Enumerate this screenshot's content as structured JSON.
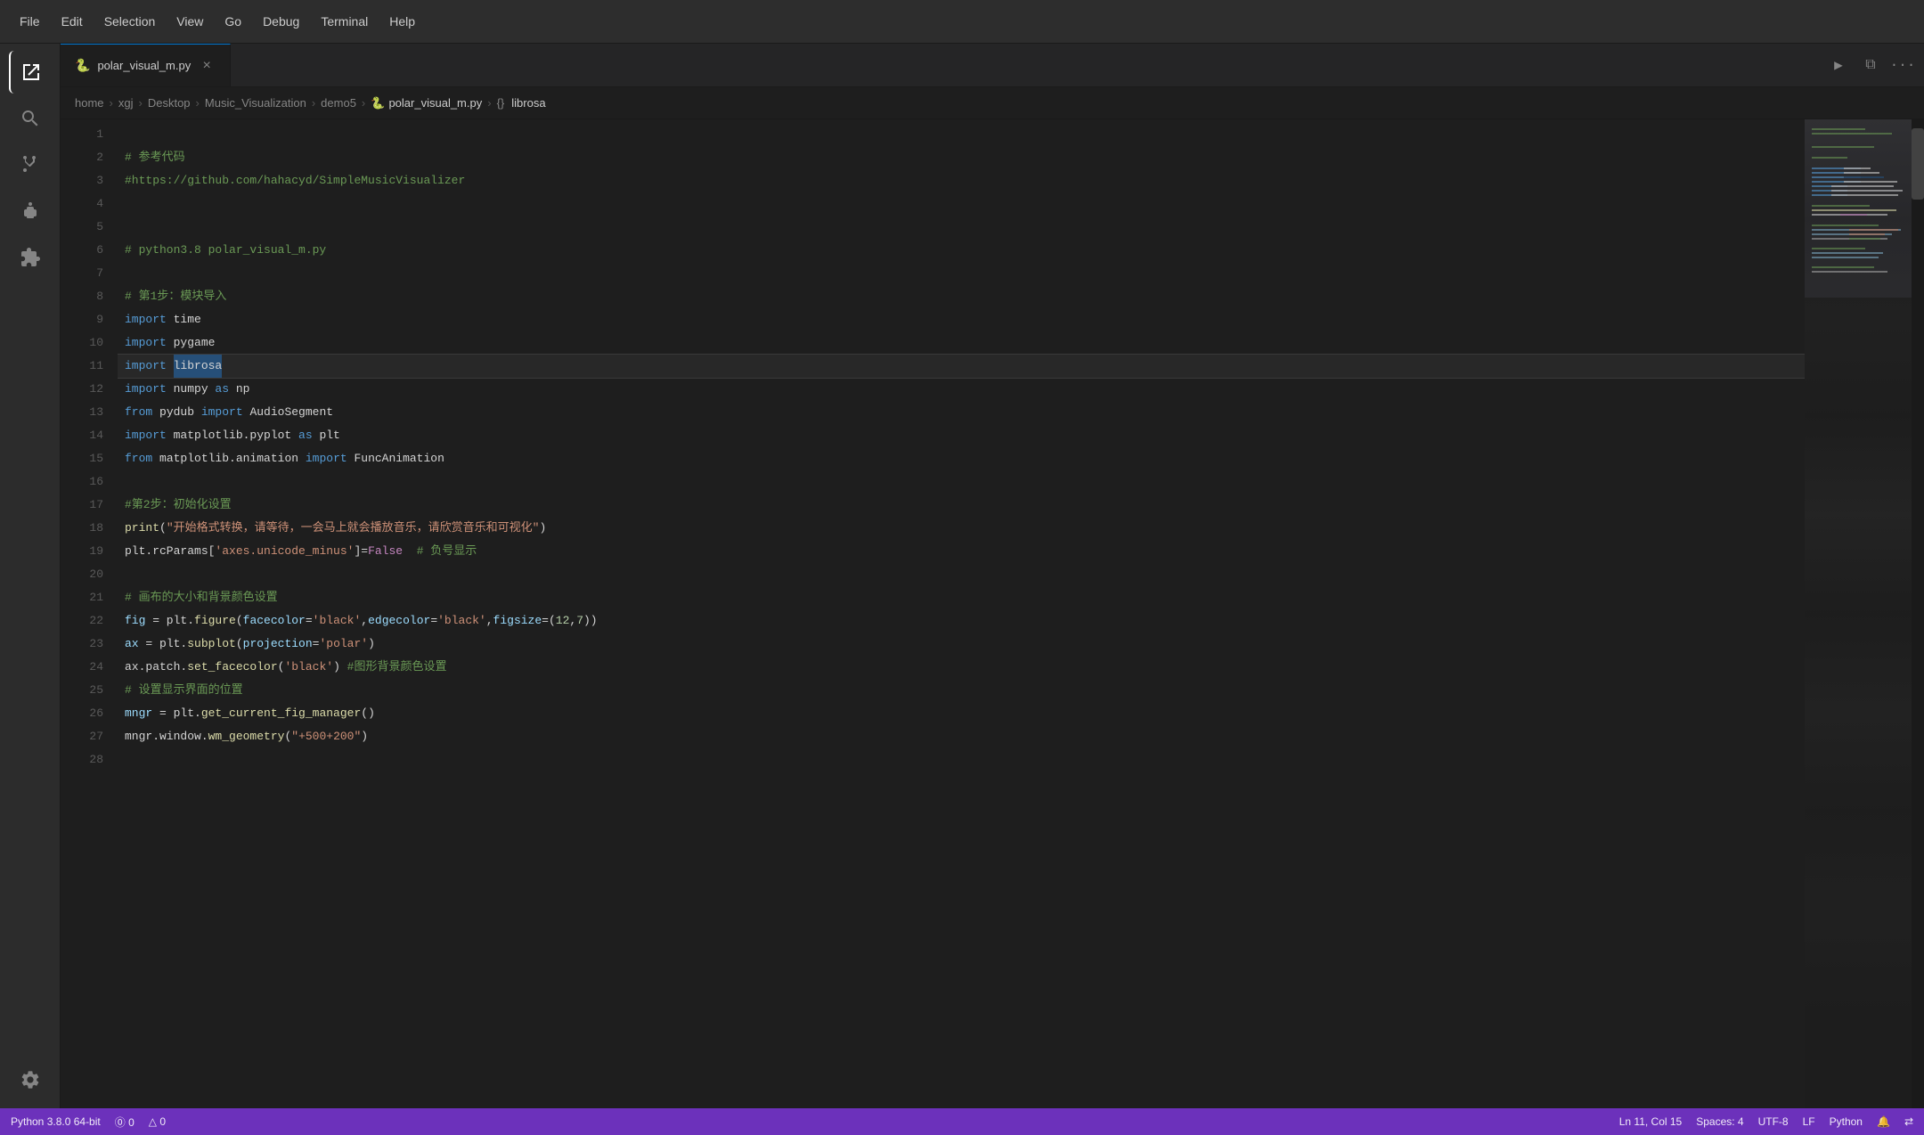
{
  "menu": {
    "items": [
      "File",
      "Edit",
      "Selection",
      "View",
      "Go",
      "Debug",
      "Terminal",
      "Help"
    ]
  },
  "activity_bar": {
    "icons": [
      {
        "name": "explorer-icon",
        "symbol": "⧉",
        "active": true
      },
      {
        "name": "search-icon",
        "symbol": "🔍",
        "active": false
      },
      {
        "name": "source-control-icon",
        "symbol": "⑂",
        "active": false
      },
      {
        "name": "debug-icon",
        "symbol": "🐞",
        "active": false
      },
      {
        "name": "extensions-icon",
        "symbol": "⊞",
        "active": false
      }
    ],
    "bottom_icons": [
      {
        "name": "settings-icon",
        "symbol": "⚙",
        "active": false
      }
    ]
  },
  "tab": {
    "filename": "polar_visual_m.py",
    "icon": "🐍",
    "close_label": "×"
  },
  "tab_actions": {
    "run_label": "▶",
    "split_label": "⧉",
    "more_label": "···"
  },
  "breadcrumb": {
    "parts": [
      "home",
      "xgj",
      "Desktop",
      "Music_Visualization",
      "demo5",
      "polar_visual_m.py",
      "librosa"
    ],
    "separators": [
      ">",
      ">",
      ">",
      ">",
      ">",
      ">"
    ]
  },
  "code": {
    "lines": [
      {
        "num": 1,
        "content": "",
        "tokens": []
      },
      {
        "num": 2,
        "content": "# 参考代码",
        "tokens": [
          {
            "t": "cmt",
            "v": "# 参考代码"
          }
        ]
      },
      {
        "num": 3,
        "content": "#https://github.com/hahacyd/SimpleMusicVisualizer",
        "tokens": [
          {
            "t": "cmt",
            "v": "#https://github.com/hahacyd/SimpleMusicVisualizer"
          }
        ]
      },
      {
        "num": 4,
        "content": "",
        "tokens": []
      },
      {
        "num": 5,
        "content": "",
        "tokens": []
      },
      {
        "num": 6,
        "content": "# python3.8 polar_visual_m.py",
        "tokens": [
          {
            "t": "cmt",
            "v": "# python3.8 polar_visual_m.py"
          }
        ]
      },
      {
        "num": 7,
        "content": "",
        "tokens": []
      },
      {
        "num": 8,
        "content": "# 第1步：模块导入",
        "tokens": [
          {
            "t": "cmt",
            "v": "# 第1步：模块导入"
          }
        ]
      },
      {
        "num": 9,
        "content": "import time",
        "tokens": [
          {
            "t": "kw",
            "v": "import"
          },
          {
            "t": "plain",
            "v": " time"
          }
        ]
      },
      {
        "num": 10,
        "content": "import pygame",
        "tokens": [
          {
            "t": "kw",
            "v": "import"
          },
          {
            "t": "plain",
            "v": " pygame"
          }
        ]
      },
      {
        "num": 11,
        "content": "import librosa",
        "tokens": [
          {
            "t": "kw",
            "v": "import"
          },
          {
            "t": "plain",
            "v": " "
          },
          {
            "t": "highlight",
            "v": "librosa"
          }
        ],
        "active": true
      },
      {
        "num": 12,
        "content": "import numpy as np",
        "tokens": [
          {
            "t": "kw",
            "v": "import"
          },
          {
            "t": "plain",
            "v": " numpy "
          },
          {
            "t": "kw",
            "v": "as"
          },
          {
            "t": "plain",
            "v": " np"
          }
        ]
      },
      {
        "num": 13,
        "content": "from pydub import AudioSegment",
        "tokens": [
          {
            "t": "kw",
            "v": "from"
          },
          {
            "t": "plain",
            "v": " pydub "
          },
          {
            "t": "kw",
            "v": "import"
          },
          {
            "t": "plain",
            "v": " AudioSegment"
          }
        ]
      },
      {
        "num": 14,
        "content": "import matplotlib.pyplot as plt",
        "tokens": [
          {
            "t": "kw",
            "v": "import"
          },
          {
            "t": "plain",
            "v": " matplotlib.pyplot "
          },
          {
            "t": "kw",
            "v": "as"
          },
          {
            "t": "plain",
            "v": " plt"
          }
        ]
      },
      {
        "num": 15,
        "content": "from matplotlib.animation import FuncAnimation",
        "tokens": [
          {
            "t": "kw",
            "v": "from"
          },
          {
            "t": "plain",
            "v": " matplotlib.animation "
          },
          {
            "t": "kw",
            "v": "import"
          },
          {
            "t": "plain",
            "v": " FuncAnimation"
          }
        ]
      },
      {
        "num": 16,
        "content": "",
        "tokens": []
      },
      {
        "num": 17,
        "content": "#第2步：初始化设置",
        "tokens": [
          {
            "t": "cmt",
            "v": "#第2步：初始化设置"
          }
        ]
      },
      {
        "num": 18,
        "content": "print(\"开始格式转换，请等待，一会马上就会播放音乐，请欣赏音乐和可视化\")",
        "tokens": [
          {
            "t": "fn",
            "v": "print"
          },
          {
            "t": "plain",
            "v": "("
          },
          {
            "t": "str",
            "v": "\"开始格式转换，请等待，一会马上就会播放音乐，请欣赏音乐和可视化\""
          },
          {
            "t": "plain",
            "v": ")"
          }
        ]
      },
      {
        "num": 19,
        "content": "plt.rcParams['axes.unicode_minus']=False  # 负号显示",
        "tokens": [
          {
            "t": "plain",
            "v": "plt.rcParams["
          },
          {
            "t": "str",
            "v": "'axes.unicode_minus'"
          },
          {
            "t": "plain",
            "v": "]="
          },
          {
            "t": "special",
            "v": "False"
          },
          {
            "t": "plain",
            "v": "  "
          },
          {
            "t": "cmt",
            "v": "# 负号显示"
          }
        ]
      },
      {
        "num": 20,
        "content": "",
        "tokens": []
      },
      {
        "num": 21,
        "content": "# 画布的大小和背景颜色设置",
        "tokens": [
          {
            "t": "cmt",
            "v": "# 画布的大小和背景颜色设置"
          }
        ]
      },
      {
        "num": 22,
        "content": "fig = plt.figure(facecolor='black',edgecolor='black',figsize=(12,7))",
        "tokens": [
          {
            "t": "var",
            "v": "fig"
          },
          {
            "t": "plain",
            "v": " = plt."
          },
          {
            "t": "fn",
            "v": "figure"
          },
          {
            "t": "plain",
            "v": "("
          },
          {
            "t": "param",
            "v": "facecolor"
          },
          {
            "t": "plain",
            "v": "="
          },
          {
            "t": "str",
            "v": "'black'"
          },
          {
            "t": "plain",
            "v": ","
          },
          {
            "t": "param",
            "v": "edgecolor"
          },
          {
            "t": "plain",
            "v": "="
          },
          {
            "t": "str",
            "v": "'black'"
          },
          {
            "t": "plain",
            "v": ","
          },
          {
            "t": "param",
            "v": "figsize"
          },
          {
            "t": "plain",
            "v": "=("
          },
          {
            "t": "num",
            "v": "12"
          },
          {
            "t": "plain",
            "v": ","
          },
          {
            "t": "num",
            "v": "7"
          },
          {
            "t": "plain",
            "v": "))"
          }
        ]
      },
      {
        "num": 23,
        "content": "ax = plt.subplot(projection='polar')",
        "tokens": [
          {
            "t": "var",
            "v": "ax"
          },
          {
            "t": "plain",
            "v": " = plt."
          },
          {
            "t": "fn",
            "v": "subplot"
          },
          {
            "t": "plain",
            "v": "("
          },
          {
            "t": "param",
            "v": "projection"
          },
          {
            "t": "plain",
            "v": "="
          },
          {
            "t": "str",
            "v": "'polar'"
          },
          {
            "t": "plain",
            "v": ")"
          }
        ]
      },
      {
        "num": 24,
        "content": "ax.patch.set_facecolor('black') #图形背景颜色设置",
        "tokens": [
          {
            "t": "plain",
            "v": "ax.patch."
          },
          {
            "t": "fn",
            "v": "set_facecolor"
          },
          {
            "t": "plain",
            "v": "("
          },
          {
            "t": "str",
            "v": "'black'"
          },
          {
            "t": "plain",
            "v": ") "
          },
          {
            "t": "cmt",
            "v": "#图形背景颜色设置"
          }
        ]
      },
      {
        "num": 25,
        "content": "# 设置显示界面的位置",
        "tokens": [
          {
            "t": "cmt",
            "v": "# 设置显示界面的位置"
          }
        ]
      },
      {
        "num": 26,
        "content": "mngr = plt.get_current_fig_manager()",
        "tokens": [
          {
            "t": "var",
            "v": "mngr"
          },
          {
            "t": "plain",
            "v": " = plt."
          },
          {
            "t": "fn",
            "v": "get_current_fig_manager"
          },
          {
            "t": "plain",
            "v": "()"
          }
        ]
      },
      {
        "num": 27,
        "content": "mngr.window.wm_geometry(\"+500+200\")",
        "tokens": [
          {
            "t": "plain",
            "v": "mngr.window."
          },
          {
            "t": "fn",
            "v": "wm_geometry"
          },
          {
            "t": "plain",
            "v": "("
          },
          {
            "t": "str",
            "v": "\"+500+200\""
          },
          {
            "t": "plain",
            "v": ")"
          }
        ]
      },
      {
        "num": 28,
        "content": "",
        "tokens": []
      }
    ]
  },
  "status_bar": {
    "python_version": "Python 3.8.0 64-bit",
    "errors": "⓪ 0",
    "warnings": "△ 0",
    "position": "Ln 11, Col 15",
    "spaces": "Spaces: 4",
    "encoding": "UTF-8",
    "line_ending": "LF",
    "language": "Python",
    "bell_icon": "🔔",
    "sync_icon": "⇄"
  }
}
